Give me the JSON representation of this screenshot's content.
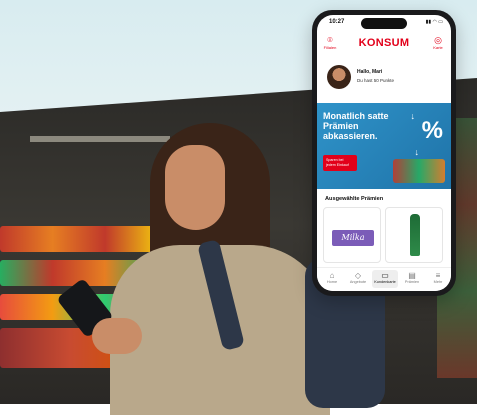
{
  "app": {
    "status_time": "10:27",
    "status_icons": "▮▮ ◠ ▭",
    "logo": "KONSUM",
    "header_left": {
      "icon": "location-pin-icon",
      "label": "Filialen"
    },
    "header_right": {
      "icon": "qr-code-icon",
      "label": "Karte"
    },
    "greeting": {
      "hello": "Hallo, Mari",
      "points_text": "Du hast 50 Punkte"
    },
    "banner": {
      "headline": "Monatlich satte Prämien abkassieren.",
      "badge": "Sparen bei jedem Einkauf",
      "symbol": "%"
    },
    "section_title": "Ausgewählte Prämien",
    "rewards": [
      {
        "name": "Milka",
        "kind": "chocolate"
      },
      {
        "name": "",
        "kind": "bottle"
      }
    ],
    "tabs": [
      {
        "icon": "home-icon",
        "label": "Home",
        "active": false
      },
      {
        "icon": "tag-icon",
        "label": "Angebote",
        "active": false
      },
      {
        "icon": "card-icon",
        "label": "Kundenkarte",
        "active": true
      },
      {
        "icon": "coupon-icon",
        "label": "Prämien",
        "active": false
      },
      {
        "icon": "menu-icon",
        "label": "Mehr",
        "active": false
      }
    ]
  },
  "colors": {
    "brand": "#e2001a",
    "banner": "#2f93c9",
    "top_band": "#d8ecf0"
  }
}
